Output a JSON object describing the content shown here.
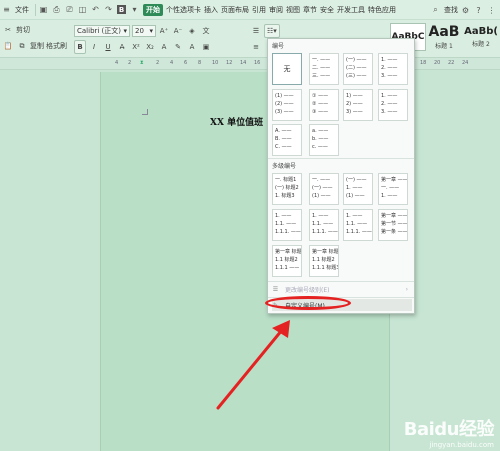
{
  "menubar": {
    "items": [
      "文件",
      "开始",
      "个性选项卡",
      "插入",
      "页面布局",
      "引用",
      "审阅",
      "视图",
      "章节",
      "安全",
      "开发工具",
      "特色应用"
    ],
    "search_label": "查找"
  },
  "toolbar": {
    "clipboard": {
      "cut": "剪切",
      "copy": "复制",
      "paste_format": "格式刷",
      "paste": "粘贴"
    },
    "font_name": "Calibri (正文)",
    "font_size": "20",
    "bold": "B",
    "italic": "I",
    "underline": "U",
    "styles": [
      {
        "preview": "AaBbC",
        "caption": ""
      },
      {
        "preview": "AaB",
        "caption": "标题 1"
      },
      {
        "preview": "AaBb(",
        "caption": "标题 2"
      }
    ]
  },
  "ruler": {
    "ticks": [
      "4",
      "2",
      "2",
      "4",
      "6",
      "8",
      "10",
      "12",
      "14",
      "16",
      "18",
      "20",
      "22",
      "24"
    ]
  },
  "document": {
    "title": "XX 单位值班"
  },
  "numbering_menu": {
    "section_numbering": "编号",
    "section_multilevel": "多级编号",
    "none_label": "无",
    "single_cells": [
      "一. ——\n二. ——\n三. ——",
      "(一) ——\n(二) ——\n(三) ——",
      "1. ——\n2. ——\n3. ——",
      "(1) ——\n(2) ——\n(3) ——",
      "① ——\n② ——\n③ ——",
      "1) ——\n2) ——\n3) ——",
      "1. ——\n2. ——\n3. ——",
      "A. ——\nB. ——\nC. ——",
      "a. ——\nb. ——\nc. ——"
    ],
    "multi_cells": [
      "一. 标题1\n(一) 标题2\n1. 标题3",
      "一. ——\n(一) ——\n(1) ——",
      "(一) ——\n1. ——\n(1) ——",
      "第一章 ——\n一. ——\n1. ——",
      "1. ——\n1.1. ——\n1.1.1. ——",
      "1. ——\n1.1. ——\n1.1.1. ——",
      "1. ——\n1.1. ——\n1.1.1. ——",
      "第一章 ——\n第一节 ——\n第一条 ——",
      "第一章 标题1\n1.1 标题2\n1.1.1 ——",
      "第一章 标题1\n1.1 标题2\n1.1.1 标题3"
    ],
    "change_label": "更改编号级别(E)",
    "custom_label": "自定义编号(M)..."
  },
  "watermark": {
    "logo": "Baidu经验",
    "url": "jingyan.baidu.com"
  },
  "colors": {
    "accent": "#2e8b57",
    "annotation": "#e52222",
    "page": "#b9dfc7"
  }
}
